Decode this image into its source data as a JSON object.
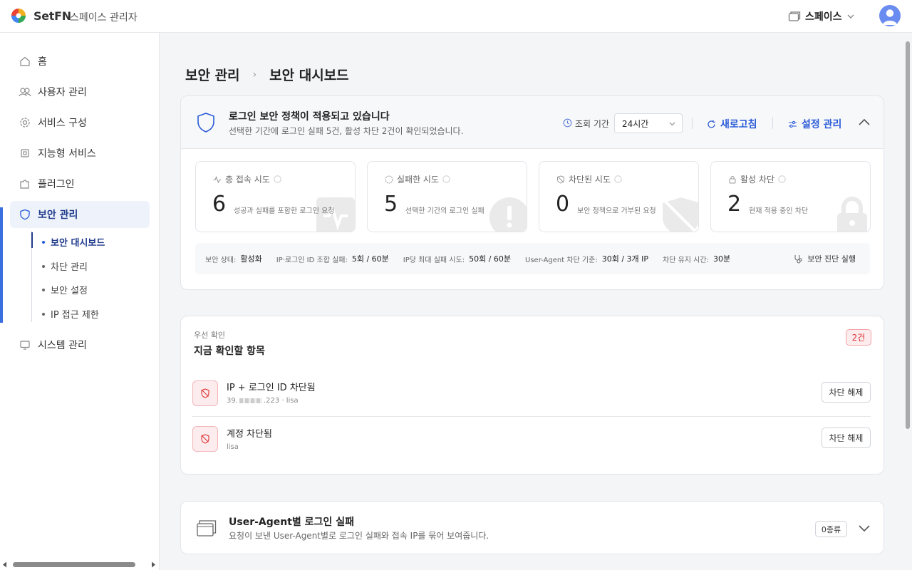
{
  "header": {
    "brand": "SetFN",
    "subtitle": "스페이스 관리자",
    "space_label": "스페이스"
  },
  "sidebar": {
    "items": [
      {
        "label": "홈",
        "icon": "home-icon"
      },
      {
        "label": "사용자 관리",
        "icon": "users-icon"
      },
      {
        "label": "서비스 구성",
        "icon": "gear-icon"
      },
      {
        "label": "지능형 서비스",
        "icon": "chip-icon"
      },
      {
        "label": "플러그인",
        "icon": "puzzle-icon"
      },
      {
        "label": "보안 관리",
        "icon": "shield-icon"
      },
      {
        "label": "시스템 관리",
        "icon": "monitor-icon"
      }
    ],
    "sub_items": [
      {
        "label": "보안 대시보드"
      },
      {
        "label": "차단 관리"
      },
      {
        "label": "보안 설정"
      },
      {
        "label": "IP 접근 제한"
      }
    ]
  },
  "breadcrumb": {
    "parent": "보안 관리",
    "current": "보안 대시보드"
  },
  "policy": {
    "title": "로그인 보안 정책이 적용되고 있습니다",
    "subtitle": "선택한 기간에 로그인 실패 5건, 활성 차단 2건이 확인되었습니다.",
    "period_label": "조회 기간",
    "period_value": "24시간",
    "refresh_label": "새로고침",
    "settings_label": "설정 관리"
  },
  "stats": [
    {
      "label": "총 접속 시도",
      "value": "6",
      "desc": "성공과 실패를 포함한 로그인 요청"
    },
    {
      "label": "실패한 시도",
      "value": "5",
      "desc": "선택한 기간의 로그인 실패"
    },
    {
      "label": "차단된 시도",
      "value": "0",
      "desc": "보안 정책으로 거부된 요청"
    },
    {
      "label": "활성 차단",
      "value": "2",
      "desc": "현재 적용 중인 차단"
    }
  ],
  "info_bar": {
    "status_label": "보안 상태:",
    "status_value": "활성화",
    "ip_login_label": "IP·로그인 ID 조합 실패:",
    "ip_login_value": "5회 / 60분",
    "ip_max_label": "IP당 최대 실패 시도:",
    "ip_max_value": "50회 / 60분",
    "ua_label": "User-Agent 차단 기준:",
    "ua_value": "30회 / 3개 IP",
    "keep_label": "차단 유지 시간:",
    "keep_value": "30분",
    "diag_label": "보안 진단 실행"
  },
  "priority": {
    "eyebrow": "우선 확인",
    "title": "지금 확인할 항목",
    "count": "2건",
    "rows": [
      {
        "title": "IP + 로그인 ID  차단됨",
        "meta_prefix": "39.",
        "meta_suffix": ".223 · lisa",
        "action": "차단 해제"
      },
      {
        "title": "계정  차단됨",
        "meta": "lisa",
        "action": "차단 해제"
      }
    ]
  },
  "ua_section": {
    "title": "User-Agent별 로그인 실패",
    "subtitle": "요청이 보낸 User-Agent별로 로그인 실패와 접속 IP를 묶어 보여줍니다.",
    "count": "0종류"
  },
  "colors": {
    "accent": "#2a5bd7",
    "danger": "#d33333",
    "active_bg": "#eef2fb"
  }
}
